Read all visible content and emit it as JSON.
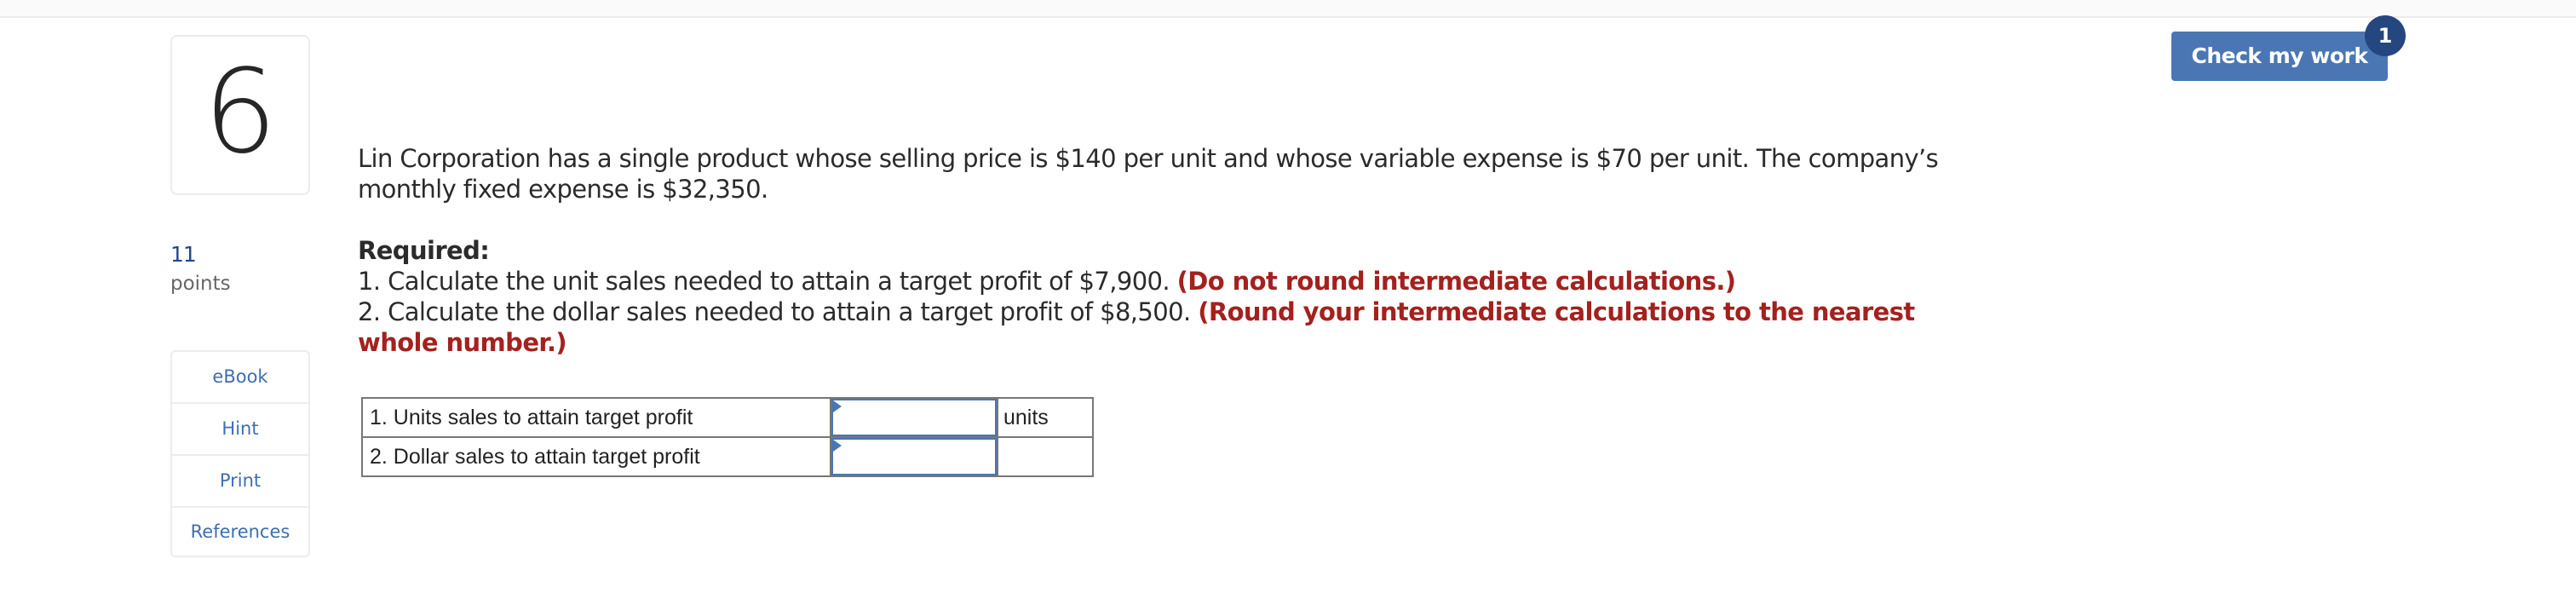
{
  "question": {
    "number": "6",
    "points_value": "11",
    "points_label": "points",
    "intro": "Lin Corporation has a single product whose selling price is $140 per unit and whose variable expense is $70 per unit. The company’s monthly fixed expense is $32,350.",
    "required_title": "Required:",
    "requirements": [
      {
        "text": "1. Calculate the unit sales needed to attain a target profit of $7,900.",
        "note": "(Do not round intermediate calculations.)"
      },
      {
        "text": "2. Calculate the dollar sales needed to attain a target profit of $8,500.",
        "note": "(Round your intermediate calculations to the nearest whole number.)"
      }
    ]
  },
  "resources": {
    "items": [
      {
        "label": "eBook"
      },
      {
        "label": "Hint"
      },
      {
        "label": "Print"
      },
      {
        "label": "References"
      }
    ]
  },
  "toolbar": {
    "check_label": "Check my work",
    "check_badge": "1"
  },
  "answer_table": {
    "rows": [
      {
        "label": "1. Units sales to attain target profit",
        "value": "",
        "unit": "units"
      },
      {
        "label": "2. Dollar sales to attain target profit",
        "value": "",
        "unit": ""
      }
    ]
  },
  "colors": {
    "accent": "#4a76b4",
    "badge": "#24477f",
    "note_red": "#a3211e",
    "link": "#3d6fb0"
  }
}
